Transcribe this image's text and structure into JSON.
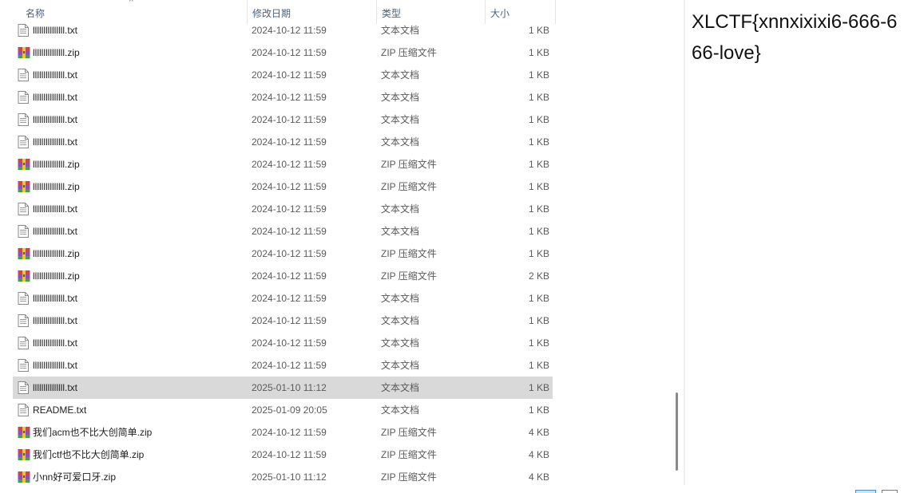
{
  "header": {
    "name_col": "名称",
    "date_col": "修改日期",
    "type_col": "类型",
    "size_col": "大小"
  },
  "files": [
    {
      "name": "lllllllllllllll.txt",
      "date": "2024-10-12 11:59",
      "type": "文本文档",
      "size": "1 KB",
      "kind": "txt"
    },
    {
      "name": "lllllllllllllll.zip",
      "date": "2024-10-12 11:59",
      "type": "ZIP 压缩文件",
      "size": "1 KB",
      "kind": "zip"
    },
    {
      "name": "lllllllllllllll.txt",
      "date": "2024-10-12 11:59",
      "type": "文本文档",
      "size": "1 KB",
      "kind": "txt"
    },
    {
      "name": "lllllllllllllll.txt",
      "date": "2024-10-12 11:59",
      "type": "文本文档",
      "size": "1 KB",
      "kind": "txt"
    },
    {
      "name": "lllllllllllllll.txt",
      "date": "2024-10-12 11:59",
      "type": "文本文档",
      "size": "1 KB",
      "kind": "txt"
    },
    {
      "name": "lllllllllllllll.txt",
      "date": "2024-10-12 11:59",
      "type": "文本文档",
      "size": "1 KB",
      "kind": "txt"
    },
    {
      "name": "lllllllllllllll.zip",
      "date": "2024-10-12 11:59",
      "type": "ZIP 压缩文件",
      "size": "1 KB",
      "kind": "zip"
    },
    {
      "name": "lllllllllllllll.zip",
      "date": "2024-10-12 11:59",
      "type": "ZIP 压缩文件",
      "size": "1 KB",
      "kind": "zip"
    },
    {
      "name": "lllllllllllllll.txt",
      "date": "2024-10-12 11:59",
      "type": "文本文档",
      "size": "1 KB",
      "kind": "txt"
    },
    {
      "name": "lllllllllllllll.txt",
      "date": "2024-10-12 11:59",
      "type": "文本文档",
      "size": "1 KB",
      "kind": "txt"
    },
    {
      "name": "lllllllllllllll.zip",
      "date": "2024-10-12 11:59",
      "type": "ZIP 压缩文件",
      "size": "1 KB",
      "kind": "zip"
    },
    {
      "name": "lllllllllllllll.zip",
      "date": "2024-10-12 11:59",
      "type": "ZIP 压缩文件",
      "size": "2 KB",
      "kind": "zip"
    },
    {
      "name": "lllllllllllllll.txt",
      "date": "2024-10-12 11:59",
      "type": "文本文档",
      "size": "1 KB",
      "kind": "txt"
    },
    {
      "name": "lllllllllllllll.txt",
      "date": "2024-10-12 11:59",
      "type": "文本文档",
      "size": "1 KB",
      "kind": "txt"
    },
    {
      "name": "lllllllllllllll.txt",
      "date": "2024-10-12 11:59",
      "type": "文本文档",
      "size": "1 KB",
      "kind": "txt"
    },
    {
      "name": "lllllllllllllll.txt",
      "date": "2024-10-12 11:59",
      "type": "文本文档",
      "size": "1 KB",
      "kind": "txt"
    },
    {
      "name": "lllllllllllllll.txt",
      "date": "2025-01-10 11:12",
      "type": "文本文档",
      "size": "1 KB",
      "kind": "txt",
      "selected": true
    },
    {
      "name": "README.txt",
      "date": "2025-01-09 20:05",
      "type": "文本文档",
      "size": "1 KB",
      "kind": "txt"
    },
    {
      "name": "我们acm也不比大创简单.zip",
      "date": "2024-10-12 11:59",
      "type": "ZIP 压缩文件",
      "size": "4 KB",
      "kind": "zip"
    },
    {
      "name": "我们ctf也不比大创简单.zip",
      "date": "2024-10-12 11:59",
      "type": "ZIP 压缩文件",
      "size": "4 KB",
      "kind": "zip"
    },
    {
      "name": "小nn好可爱口牙.zip",
      "date": "2025-01-10 11:12",
      "type": "ZIP 压缩文件",
      "size": "4 KB",
      "kind": "zip"
    }
  ],
  "preview": {
    "text": "XLCTF{xnnxixixi6-666-666-love}"
  },
  "icons": {
    "txt": "text-file-icon",
    "zip": "zip-archive-icon"
  },
  "colors": {
    "selected_row": "#d9d9d9",
    "header_text": "#4c607a"
  }
}
